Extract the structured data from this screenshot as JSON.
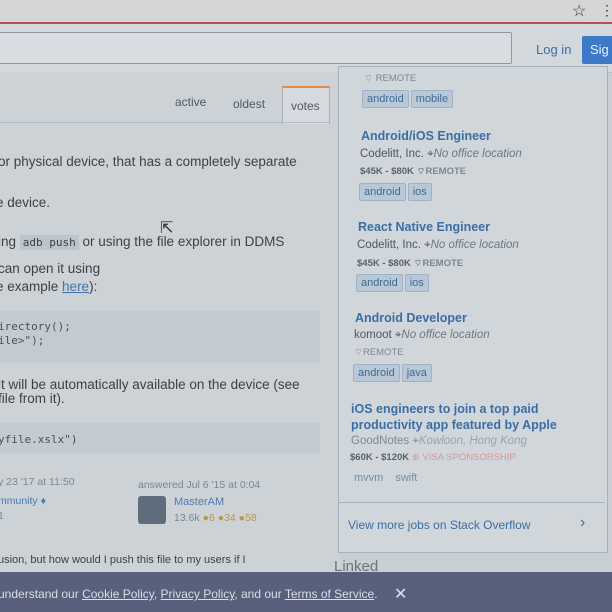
{
  "browser": {
    "star_icon": "star-icon",
    "menu_icon": "more-icon"
  },
  "nav": {
    "login": "Log in",
    "signup": "Sig"
  },
  "tabs": [
    "active",
    "oldest",
    "votes"
  ],
  "answer": {
    "line1": "or physical device, that has a completely separate",
    "line2": "e device.",
    "line3_pre": "ing ",
    "line3_code": "adb push",
    "line3_post": " or using the file explorer in DDMS",
    "line4": "can open it using",
    "line5_pre": "e example ",
    "line5_link": "here",
    "line5_post": "):",
    "code1_l1": "irectory();",
    "code1_l2": "ile>\");",
    "line6": "it will be automatically available on the device (see",
    "line7": "file from it).",
    "code2": "yfile.xslx\")",
    "edited": "y 23 '17 at 11:50",
    "community": "mmunity ♦",
    "community_rep": "1",
    "answered": "answered Jul 6 '15 at 0:04",
    "author": "MasterAM",
    "author_rep": "13.6k",
    "badges": "●6  ●34  ●58",
    "comment": "usion, but how would I push this file to my users if I"
  },
  "jobs": {
    "top_remote": "REMOTE",
    "top_tags": [
      "android",
      "mobile"
    ],
    "items": [
      {
        "title": "Android/iOS Engineer",
        "company": "Codelitt, Inc.",
        "location": "No office location",
        "salary": "$45K - $80K",
        "remote": "REMOTE",
        "tags": [
          "android",
          "ios"
        ]
      },
      {
        "title": "React Native Engineer",
        "company": "Codelitt, Inc.",
        "location": "No office location",
        "salary": "$45K - $80K",
        "remote": "REMOTE",
        "tags": [
          "android",
          "ios"
        ]
      },
      {
        "title": "Android Developer",
        "company": "komoot",
        "location": "No office location",
        "remote": "REMOTE",
        "tags": [
          "android",
          "java"
        ]
      },
      {
        "title1": "iOS engineers to join a top paid",
        "title2": "productivity app featured by Apple",
        "company": "GoodNotes",
        "location": "Kowloon, Hong Kong",
        "salary": "$60K - $120K",
        "visa": "VISA SPONSORSHIP",
        "tags": [
          "mvvm",
          "swift"
        ]
      }
    ],
    "view_more": "View more jobs on Stack Overflow"
  },
  "linked": "Linked",
  "cookie": {
    "pre": "understand our ",
    "cookie_policy": "Cookie Policy",
    "sep1": ", ",
    "privacy_policy": "Privacy Policy",
    "sep2": ", and our ",
    "terms": "Terms of Service",
    "post": "."
  },
  "colors": {
    "accent": "#3c7ac7",
    "link": "#3a6ea5",
    "cookie_bar": "#59607c",
    "tab_highlight": "#e58a4b"
  }
}
